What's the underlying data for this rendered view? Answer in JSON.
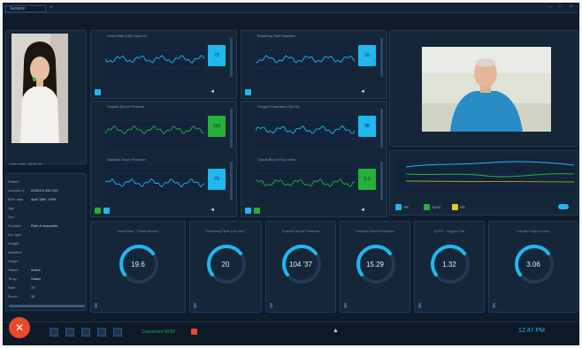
{
  "window": {
    "tab_label": "Session",
    "tab_close": "×",
    "minimize": "–",
    "maximize": "▫",
    "close": "×"
  },
  "patient_panel": {
    "caption": "Connected: 00:00:00",
    "rows": [
      {
        "label": "Patient",
        "value": ""
      },
      {
        "label": "Account #",
        "value": "A1B2C3 450 003"
      },
      {
        "label": "Birth date",
        "value": "April 18th, 1999"
      },
      {
        "label": "Age",
        "value": ""
      },
      {
        "label": "Sex",
        "value": ""
      },
      {
        "label": "Provider",
        "value": "Ruth & Associate"
      },
      {
        "label": "Ins. type",
        "value": ""
      },
      {
        "label": "Weight",
        "value": ""
      },
      {
        "label": "Admitted",
        "value": ""
      },
      {
        "label": "Height",
        "value": ""
      },
      {
        "label": "Status",
        "value": "Active"
      },
      {
        "label": "Temp",
        "value": "Stable"
      },
      {
        "label": "Rate",
        "value": "72"
      },
      {
        "label": "Room",
        "value": "12"
      }
    ]
  },
  "charts": [
    {
      "title": "Heart Rate (HR) Spectral"
    },
    {
      "title": "Breathing Rate Spectral"
    },
    {
      "title": "Systolic Blood Pressure"
    },
    {
      "title": "Oxygen Saturation (SpO2)"
    },
    {
      "title": "Diastolic Blood Pressure"
    },
    {
      "title": "Global Blood Flow Index"
    }
  ],
  "chart_values": [
    "72",
    "16",
    "118",
    "98",
    "76",
    "3.2"
  ],
  "trend_legend": [
    "HR",
    "SpO2",
    "RR"
  ],
  "gauges": [
    {
      "title": "Heart Rate · Pulse Monitor",
      "value": "19.6"
    },
    {
      "title": "Breathing Rate (per min)",
      "value": "20"
    },
    {
      "title": "Systolic Blood Pressure",
      "value": "104 '37"
    },
    {
      "title": "Diastolic Blood Pressure",
      "value": "15.29"
    },
    {
      "title": "SpO2 · Oxygen Sat",
      "value": "1.32"
    },
    {
      "title": "Cardiac Output Index",
      "value": "3.06"
    }
  ],
  "taskbar": {
    "status_text": "Connected 00:00",
    "clock": "12:47 PM",
    "end_call_glyph": "✕"
  },
  "colors": {
    "accent_cyan": "#1fb8f0",
    "accent_green": "#25b039",
    "accent_yellow": "#e8c923",
    "end_call_red": "#e84a2c"
  }
}
